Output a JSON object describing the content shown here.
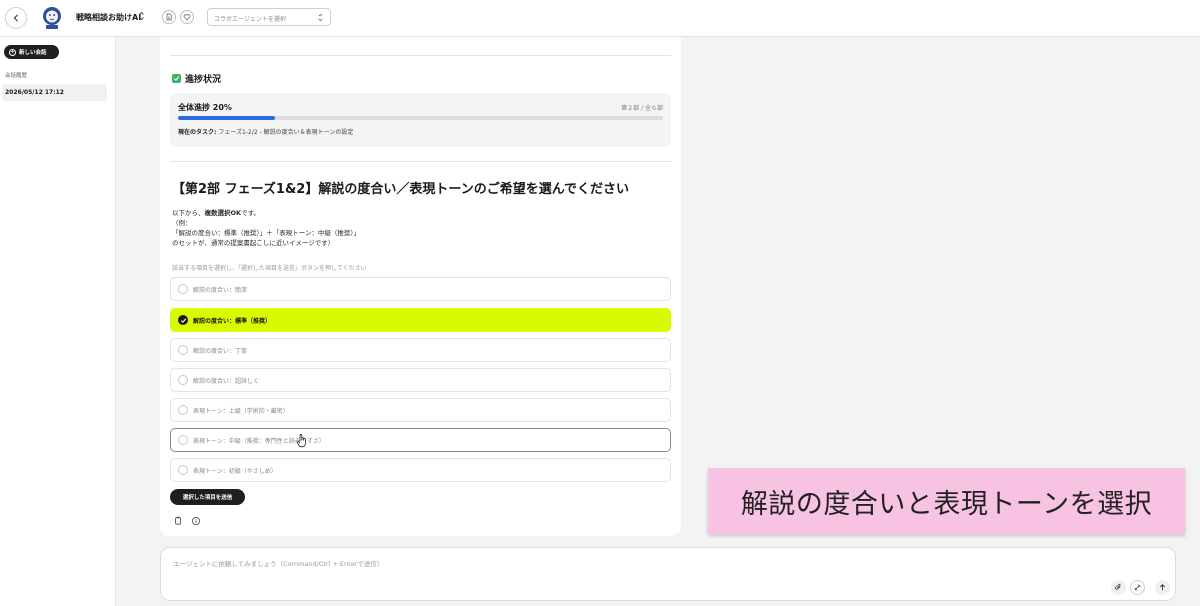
{
  "header": {
    "app_name": "戦略相談お助けAI",
    "agent_select": {
      "placeholder": "コラボエージェントを選択"
    }
  },
  "sidebar": {
    "new_chat_label": "新しい会話",
    "history_heading": "会話履歴",
    "history_items": [
      "2026/05/12 17:12"
    ]
  },
  "progress": {
    "heading": "進捗状況",
    "overall_label": "全体進捗 20%",
    "overall_fraction": 0.2,
    "part_count": "第２部 / 全６部",
    "task_prefix": "現在のタスク:",
    "task_text": "フェーズ1-2/2 - 解説の度合い＆表現トーンの設定"
  },
  "question": {
    "title": "【第2部 フェーズ1&2】解説の度合い／表現トーンのご希望を選んでください",
    "intro_lines": [
      "以下から、複数選択OKです。",
      "（例：",
      "「解説の度合い：標準（推奨）」＋「表現トーン：中級（推奨）」",
      "のセットが、通常の提案書起こしに近いイメージです）"
    ],
    "hint": "該当する項目を選択し、「選択した項目を送信」ボタンを押してください",
    "options": [
      {
        "label": "解説の度合い：簡潔",
        "selected": false
      },
      {
        "label": "解説の度合い：標準（推奨）",
        "selected": true
      },
      {
        "label": "解説の度合い：丁寧",
        "selected": false
      },
      {
        "label": "解説の度合い：超詳しく",
        "selected": false
      },
      {
        "label": "表現トーン：上級（学術的・厳密）",
        "selected": false
      },
      {
        "label": "表現トーン：中級（推奨：専門性と読みやすさ）",
        "selected": false
      },
      {
        "label": "表現トーン：初級（やさしめ）",
        "selected": false
      }
    ],
    "submit_label": "選択した項目を送信"
  },
  "composer": {
    "placeholder": "エージェントに依頼してみましょう（Command/Ctrl + Enterで送信）"
  },
  "caption": "解説の度合いと表現トーンを選択",
  "colors": {
    "selected_option": "#d8fb00",
    "progress_fill": "#2a6ee6",
    "caption_bg": "#f8c3e3",
    "check_green": "#3bb36b"
  }
}
